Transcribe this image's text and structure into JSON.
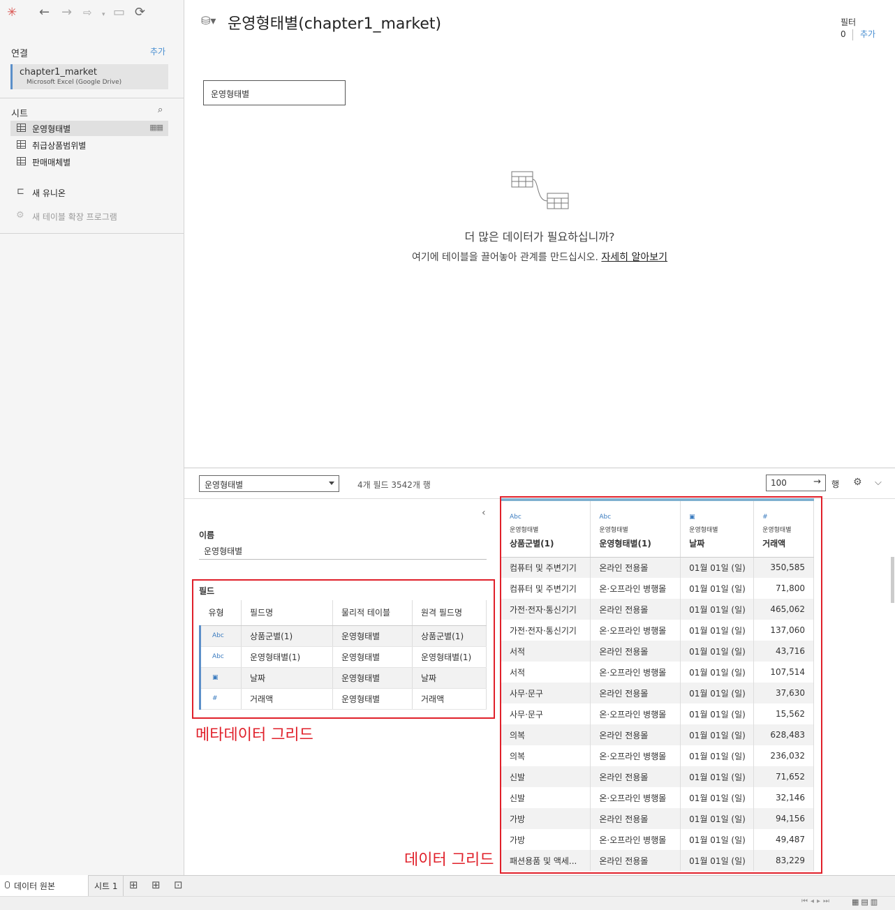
{
  "toolbar": {
    "logo": "✳",
    "back": "←",
    "forward": "→",
    "redo": "⇨",
    "save": "▭",
    "refresh": "⟳"
  },
  "connections": {
    "title": "연결",
    "add": "추가",
    "name": "chapter1_market",
    "source": "Microsoft Excel (Google Drive)"
  },
  "sheets": {
    "title": "시트",
    "items": [
      "운영형태별",
      "취급상품범위별",
      "판매매체별"
    ],
    "new_union": "새 유니온",
    "new_extension": "새 테이블 확장 프로그램"
  },
  "canvas": {
    "title": "운영형태별(chapter1_market)",
    "table": "운영형태별",
    "need_title": "더 많은 데이터가 필요하십니까?",
    "need_sub": "여기에 테이블을 끌어놓아 관계를 만드십시오.",
    "learn_more": "자세히 알아보기"
  },
  "filters": {
    "label": "필터",
    "count": "0",
    "add": "추가"
  },
  "midbar": {
    "table_select": "운영형태별",
    "field_count": "4개 필드 3542개 행",
    "rows_value": "100",
    "rows_label": "행"
  },
  "metadata": {
    "name_label": "이름",
    "name_value": "운영형태별",
    "fields_label": "필드",
    "columns": [
      "유형",
      "필드명",
      "물리적 테이블",
      "원격 필드명"
    ],
    "rows": [
      {
        "type": "Abc",
        "field": "상품군별(1)",
        "table": "운영형태별",
        "remote": "상품군별(1)"
      },
      {
        "type": "Abc",
        "field": "운영형태별(1)",
        "table": "운영형태별",
        "remote": "운영형태별(1)"
      },
      {
        "type": "▣",
        "field": "날짜",
        "table": "운영형태별",
        "remote": "날짜"
      },
      {
        "type": "#",
        "field": "거래액",
        "table": "운영형태별",
        "remote": "거래액"
      }
    ],
    "caption": "메타데이터 그리드"
  },
  "datagrid": {
    "columns": [
      {
        "type": "Abc",
        "source": "운영형태별",
        "name": "상품군별(1)"
      },
      {
        "type": "Abc",
        "source": "운영형태별",
        "name": "운영형태별(1)"
      },
      {
        "type": "▣",
        "source": "운영형태별",
        "name": "날짜"
      },
      {
        "type": "#",
        "source": "운영형태별",
        "name": "거래액"
      }
    ],
    "rows": [
      [
        "컴퓨터 및 주변기기",
        "온라인 전용몰",
        "01월 01일 (일)",
        "350,585"
      ],
      [
        "컴퓨터 및 주변기기",
        "온·오프라인 병행몰",
        "01월 01일 (일)",
        "71,800"
      ],
      [
        "가전·전자·통신기기",
        "온라인 전용몰",
        "01월 01일 (일)",
        "465,062"
      ],
      [
        "가전·전자·통신기기",
        "온·오프라인 병행몰",
        "01월 01일 (일)",
        "137,060"
      ],
      [
        "서적",
        "온라인 전용몰",
        "01월 01일 (일)",
        "43,716"
      ],
      [
        "서적",
        "온·오프라인 병행몰",
        "01월 01일 (일)",
        "107,514"
      ],
      [
        "사무·문구",
        "온라인 전용몰",
        "01월 01일 (일)",
        "37,630"
      ],
      [
        "사무·문구",
        "온·오프라인 병행몰",
        "01월 01일 (일)",
        "15,562"
      ],
      [
        "의복",
        "온라인 전용몰",
        "01월 01일 (일)",
        "628,483"
      ],
      [
        "의복",
        "온·오프라인 병행몰",
        "01월 01일 (일)",
        "236,032"
      ],
      [
        "신발",
        "온라인 전용몰",
        "01월 01일 (일)",
        "71,652"
      ],
      [
        "신발",
        "온·오프라인 병행몰",
        "01월 01일 (일)",
        "32,146"
      ],
      [
        "가방",
        "온라인 전용몰",
        "01월 01일 (일)",
        "94,156"
      ],
      [
        "가방",
        "온·오프라인 병행몰",
        "01월 01일 (일)",
        "49,487"
      ],
      [
        "패션용품 및 액세...",
        "온라인 전용몰",
        "01월 01일 (일)",
        "83,229"
      ]
    ],
    "caption": "데이터 그리드"
  },
  "tabs": {
    "data_source": "데이터 원본",
    "sheet1": "시트 1"
  },
  "colors": {
    "accent": "#4a8fd1",
    "annotation": "#e0202a",
    "type_icon": "#3a7bbf"
  }
}
